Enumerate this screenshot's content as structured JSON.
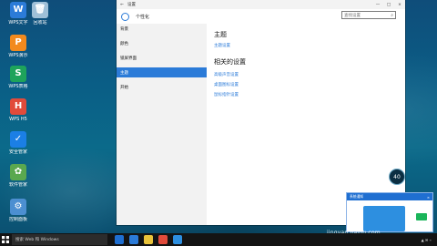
{
  "desktop": {
    "icons": [
      {
        "label": "WPS文字",
        "color": "#2b7bd8",
        "glyph": "W"
      },
      {
        "label": "WPS演示",
        "color": "#f28a1e",
        "glyph": "P"
      },
      {
        "label": "WPS表格",
        "color": "#1ea35b",
        "glyph": "S"
      },
      {
        "label": "WPS H5",
        "color": "#e14b3b",
        "glyph": "H"
      },
      {
        "label": "安全管家",
        "color": "#1b7fe5",
        "glyph": "✓"
      },
      {
        "label": "软件管家",
        "color": "#5aa84f",
        "glyph": "✿"
      },
      {
        "label": "回收站",
        "color": "#9fc0d8",
        "glyph": "🗑"
      },
      {
        "label": "控制面板",
        "color": "#4c8fd1",
        "glyph": "⚙"
      }
    ]
  },
  "window": {
    "title": "设置",
    "header": "个性化",
    "search_placeholder": "查找设置",
    "nav": [
      {
        "label": "背景",
        "active": false
      },
      {
        "label": "颜色",
        "active": false
      },
      {
        "label": "锁屏界面",
        "active": false
      },
      {
        "label": "主题",
        "active": true
      },
      {
        "label": "开始",
        "active": false
      }
    ],
    "content": {
      "section_title": "主题",
      "section_link": "主题设置",
      "related_title": "相关的设置",
      "related_links": [
        "高级声音设置",
        "桌面图标设置",
        "鼠标指针设置"
      ]
    }
  },
  "widget": {
    "value": "40"
  },
  "popup": {
    "bar_text": "系统通知",
    "close": "×"
  },
  "taskbar": {
    "search_text": "搜索 Web 和 Windows"
  },
  "watermark": {
    "text": "jingyan.baidu.com"
  }
}
